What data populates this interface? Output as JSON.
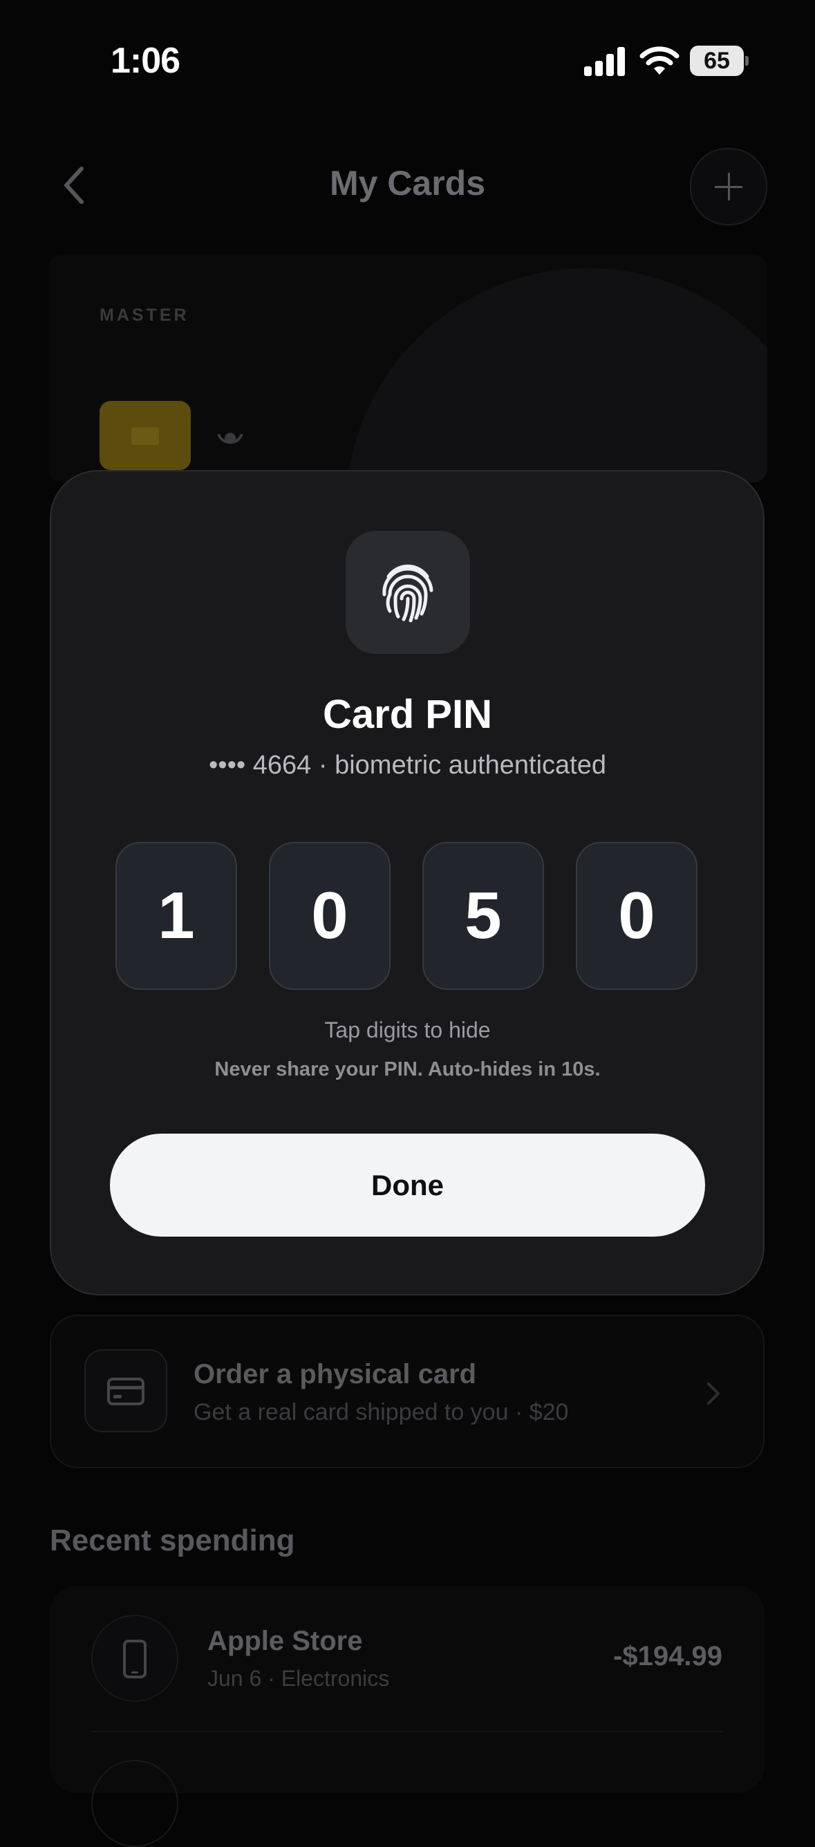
{
  "status_bar": {
    "time": "1:06",
    "battery": "65"
  },
  "header": {
    "title": "My Cards"
  },
  "card": {
    "brand": "MASTER"
  },
  "pin_modal": {
    "title": "Card PIN",
    "subtitle": "•••• 4664 · biometric authenticated",
    "digits": [
      "1",
      "0",
      "5",
      "0"
    ],
    "hint": "Tap digits to hide",
    "warning": "Never share your PIN. Auto-hides in 10s.",
    "done_label": "Done"
  },
  "order_card": {
    "title": "Order a physical card",
    "subtitle": "Get a real card shipped to you · $20"
  },
  "recent_spending": {
    "title": "Recent spending",
    "transactions": [
      {
        "name": "Apple Store",
        "meta": "Jun 6 · Electronics",
        "amount": "-$194.99"
      }
    ]
  },
  "icons": {
    "back": "chevron-left-icon",
    "add": "plus-icon",
    "biometric": "fingerprint-icon",
    "order": "credit-card-icon",
    "transaction": "phone-icon"
  }
}
